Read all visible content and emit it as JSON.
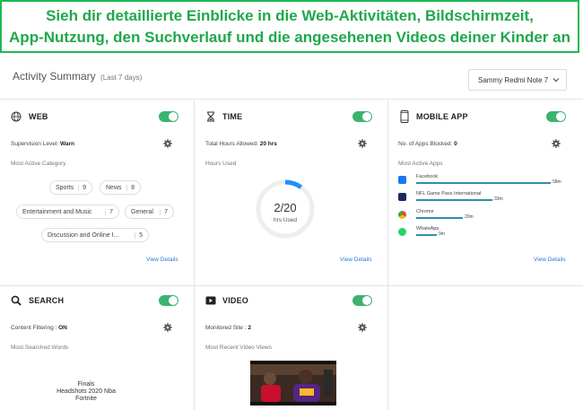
{
  "banner": {
    "line1": "Sieh dir detaillierte Einblicke in die Web-Aktivitäten, Bildschirmzeit,",
    "line2": "App-Nutzung, den Suchverlauf und die angesehenen Videos deiner Kinder an"
  },
  "summary": {
    "title": "Activity Summary",
    "period": "(Last 7 days)"
  },
  "device_select": {
    "selected": "Sammy Redmi Note 7"
  },
  "web": {
    "title": "WEB",
    "supervision_label": "Supervision Level:",
    "supervision_value": "Warn",
    "category_header": "Most Active Category",
    "categories": [
      {
        "name": "Sports",
        "count": "9"
      },
      {
        "name": "News",
        "count": "8"
      },
      {
        "name": "Entertainment and Music",
        "count": "7"
      },
      {
        "name": "General",
        "count": "7"
      },
      {
        "name": "Discussion and Online I...",
        "count": "5"
      }
    ],
    "link": "View Details",
    "enabled": true
  },
  "time": {
    "title": "TIME",
    "allowed_label": "Total Hours Allowed:",
    "allowed_value": "20 hrs",
    "used_header": "Hours Used",
    "used_value": "2/20",
    "used_caption": "hrs Used",
    "used_fraction": 0.1,
    "link": "View Details",
    "enabled": true
  },
  "mobile": {
    "title": "MOBILE APP",
    "blocked_label": "No. of Apps Blocked:",
    "blocked_value": "0",
    "apps_header": "Most Active Apps",
    "apps": [
      {
        "name": "Facebook",
        "time": "58m",
        "minutes": 58,
        "color": "#1877f2",
        "icon": "facebook-icon"
      },
      {
        "name": "NFL Game Pass International",
        "time": "33m",
        "minutes": 33,
        "color": "#1a2a5a",
        "icon": "nfl-icon"
      },
      {
        "name": "Chrome",
        "time": "20m",
        "minutes": 20,
        "color": "#e94235",
        "icon": "chrome-icon"
      },
      {
        "name": "WhatsApp",
        "time": "9m",
        "minutes": 9,
        "color": "#25d366",
        "icon": "whatsapp-icon"
      }
    ],
    "link": "View Details",
    "enabled": true
  },
  "search": {
    "title": "SEARCH",
    "filter_label": "Content Filtering :",
    "filter_value": "ON",
    "words_header": "Most Searched Words",
    "words": [
      "Finals",
      "Headshots 2020 Nba",
      "Fortnite"
    ],
    "enabled": true
  },
  "video": {
    "title": "VIDEO",
    "monitored_label": "Monitored Site :",
    "monitored_value": "2",
    "views_header": "Most Recent Video Views",
    "enabled": true
  },
  "colors": {
    "accent": "#3cb371",
    "banner": "#1fa84b",
    "bar": "#2a93a8",
    "link": "#2b7bd6",
    "ring": "#1e90ff"
  }
}
